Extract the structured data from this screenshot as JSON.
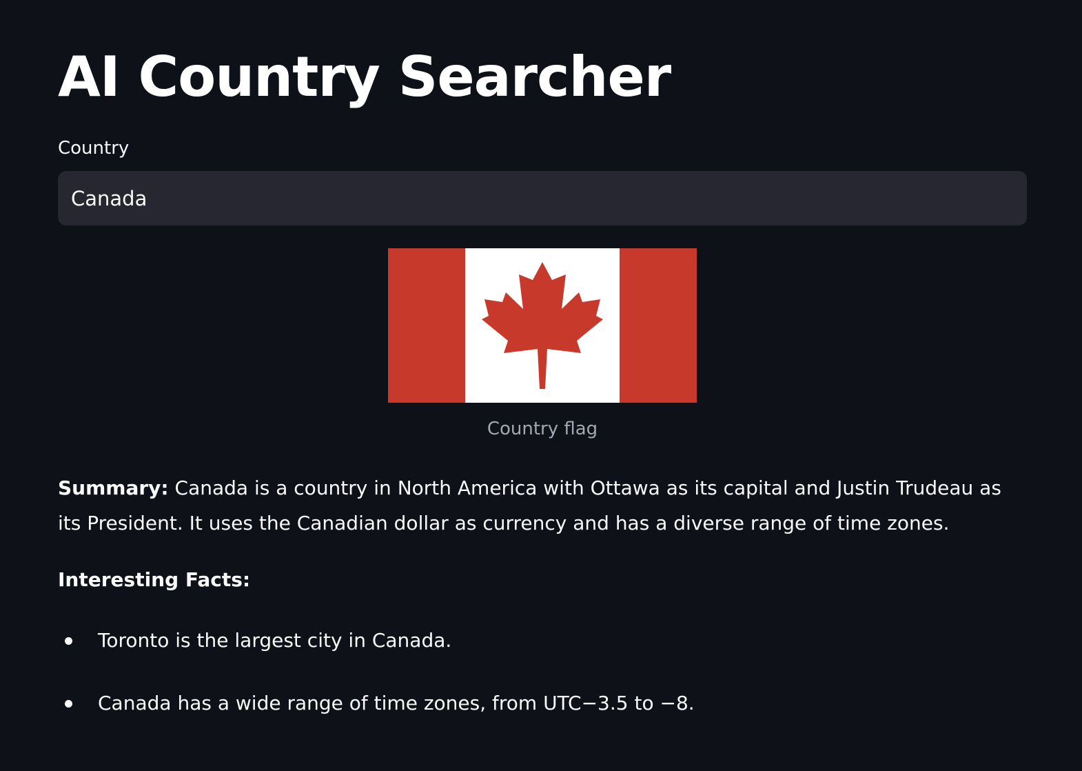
{
  "app": {
    "title": "AI Country Searcher"
  },
  "search": {
    "label": "Country",
    "value": "Canada"
  },
  "flag": {
    "caption": "Country flag",
    "icon": "canada-flag",
    "colors": {
      "red": "#c7392b",
      "white": "#ffffff"
    }
  },
  "summary": {
    "label": "Summary:",
    "text": "Canada is a country in North America with Ottawa as its capital and Justin Trudeau as its President. It uses the Canadian dollar as currency and has a diverse range of time zones."
  },
  "facts": {
    "heading": "Interesting Facts:",
    "items": [
      "Toronto is the largest city in Canada.",
      "Canada has a wide range of time zones, from UTC−3.5 to −8."
    ]
  },
  "theme": {
    "background": "#0e1117",
    "input_background": "#262730",
    "text": "#fafafa",
    "caption_text": "#a3a8b4"
  }
}
